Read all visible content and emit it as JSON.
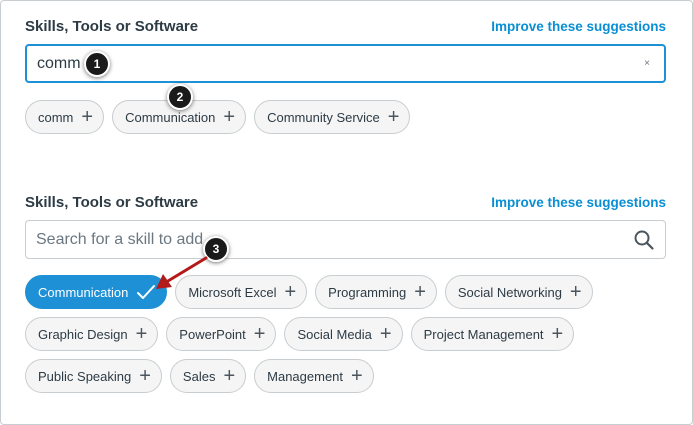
{
  "section1": {
    "heading": "Skills, Tools or Software",
    "improve_link": "Improve these suggestions",
    "search_value": "comm",
    "clear_icon": "×",
    "suggestions": [
      {
        "label": "comm"
      },
      {
        "label": "Communication"
      },
      {
        "label": "Community Service"
      }
    ]
  },
  "section2": {
    "heading": "Skills, Tools or Software",
    "improve_link": "Improve these suggestions",
    "search_placeholder": "Search for a skill to add",
    "suggestions": [
      {
        "label": "Communication",
        "selected": true
      },
      {
        "label": "Microsoft Excel"
      },
      {
        "label": "Programming"
      },
      {
        "label": "Social Networking"
      },
      {
        "label": "Graphic Design"
      },
      {
        "label": "PowerPoint"
      },
      {
        "label": "Social Media"
      },
      {
        "label": "Project Management"
      },
      {
        "label": "Public Speaking"
      },
      {
        "label": "Sales"
      },
      {
        "label": "Management"
      }
    ]
  },
  "callouts": [
    "1",
    "2",
    "3"
  ],
  "icons": {
    "add": "plus-icon",
    "selected": "checkmark-icon",
    "search": "magnifier-icon",
    "clear": "close-icon"
  },
  "colors": {
    "accent": "#1e90d6",
    "link": "#0a8fd4",
    "callout_arrow": "#b31b1b"
  }
}
